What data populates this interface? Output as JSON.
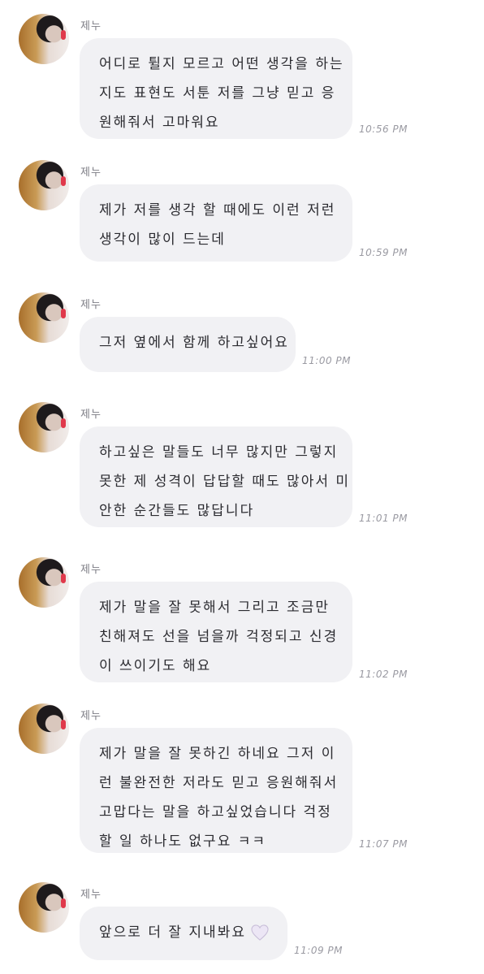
{
  "sender_name": "제누",
  "messages": [
    {
      "lines": [
        "어디로 튈지 모르고 어떤 생각을 하는",
        "지도 표현도 서툰 저를 그냥 믿고 응",
        "원해줘서 고마워요"
      ],
      "time": "10:56 PM"
    },
    {
      "lines": [
        "제가 저를 생각 할 때에도 이런 저런",
        "생각이 많이 드는데"
      ],
      "time": "10:59 PM"
    },
    {
      "lines": [
        "그저 옆에서 함께 하고싶어요"
      ],
      "time": "11:00 PM"
    },
    {
      "lines": [
        "하고싶은 말들도 너무 많지만 그렇지",
        "못한 제 성격이 답답할 때도 많아서 미",
        "안한 순간들도 많답니다"
      ],
      "time": "11:01 PM"
    },
    {
      "lines": [
        "제가 말을 잘 못해서 그리고 조금만",
        "친해져도 선을 넘을까 걱정되고 신경",
        "이 쓰이기도 해요"
      ],
      "time": "11:02 PM"
    },
    {
      "lines": [
        "제가 말을 잘 못하긴 하네요 그저 이",
        "런 불완전한 저라도 믿고 응원해줘서",
        "고맙다는 말을 하고싶었습니다 걱정",
        "할 일 하나도 없구요 ㅋㅋ"
      ],
      "time": "11:07 PM"
    },
    {
      "lines": [
        "앞으로 더 잘 지내봐요"
      ],
      "time": "11:09 PM"
    }
  ],
  "icons": {
    "avatar": "profile-photo",
    "heart": "white-heart-icon"
  },
  "colors": {
    "bubble": "#f1f1f4",
    "text": "#2b2b30",
    "time": "#9a9aa2",
    "heart": "#e9e3f3"
  }
}
